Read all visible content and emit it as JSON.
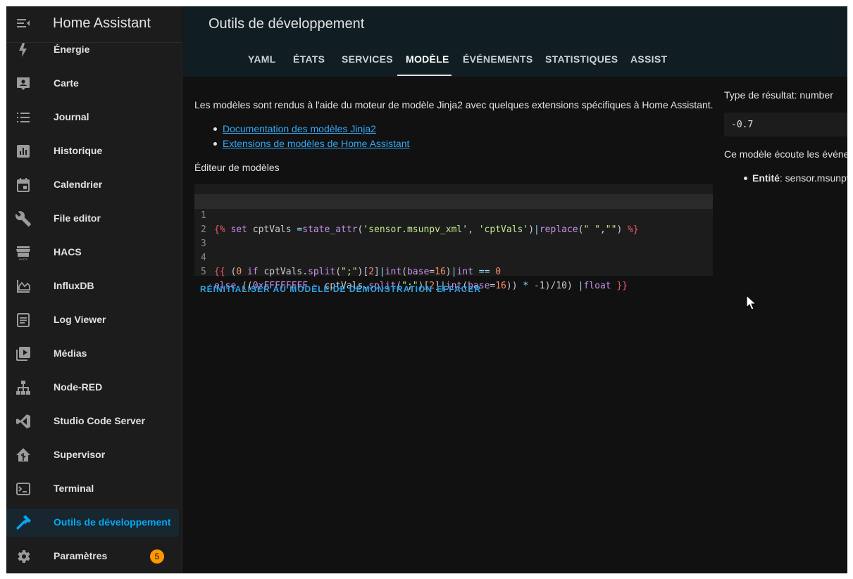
{
  "app": {
    "title": "Home Assistant"
  },
  "sidebar": {
    "items": [
      {
        "label": "Énergie",
        "icon": "lightning-bolt-icon"
      },
      {
        "label": "Carte",
        "icon": "account-box-icon"
      },
      {
        "label": "Journal",
        "icon": "list-icon"
      },
      {
        "label": "Historique",
        "icon": "chart-box-icon"
      },
      {
        "label": "Calendrier",
        "icon": "calendar-icon"
      },
      {
        "label": "File editor",
        "icon": "wrench-icon"
      },
      {
        "label": "HACS",
        "icon": "hacs-store-icon"
      },
      {
        "label": "InfluxDB",
        "icon": "area-chart-icon"
      },
      {
        "label": "Log Viewer",
        "icon": "text-document-icon"
      },
      {
        "label": "Médias",
        "icon": "play-box-multiple-icon"
      },
      {
        "label": "Node-RED",
        "icon": "sitemap-icon"
      },
      {
        "label": "Studio Code Server",
        "icon": "vscode-icon"
      },
      {
        "label": "Supervisor",
        "icon": "home-assistant-icon"
      },
      {
        "label": "Terminal",
        "icon": "console-icon"
      },
      {
        "label": "Outils de développement",
        "icon": "hammer-icon",
        "active": true
      },
      {
        "label": "Paramètres",
        "icon": "cog-icon",
        "badge": "5"
      }
    ]
  },
  "header": {
    "title": "Outils de développement",
    "tabs": [
      {
        "label": "YAML"
      },
      {
        "label": "ÉTATS"
      },
      {
        "label": "SERVICES"
      },
      {
        "label": "MODÈLE",
        "active": true
      },
      {
        "label": "ÉVÉNEMENTS"
      },
      {
        "label": "STATISTIQUES"
      },
      {
        "label": "ASSIST"
      }
    ]
  },
  "main": {
    "intro": "Les modèles sont rendus à l'aide du moteur de modèle Jinja2 avec quelques extensions spécifiques à Home Assistant.",
    "links": [
      "Documentation des modèles Jinja2",
      "Extensions de modèles de Home Assistant"
    ],
    "editor_label": "Éditeur de modèles",
    "code_lines": [
      "{% set cptVals =state_attr('sensor.msunpv_xml', 'cptVals')|replace(\" \",\"\") %}",
      "",
      "",
      "{{ (0 if cptVals.split(\";\")[2]|int(base=16)|int == 0",
      "else ((0xFFFFFFFF - cptVals.split(\";\")[2]|int(base=16)) * -1)/10) |float }}"
    ],
    "line_numbers": [
      "1",
      "2",
      "3",
      "4",
      "5"
    ],
    "reset_button": "RÉINITIALISER AU MODÈLE DE DÉMONSTRATION",
    "clear_button": "EFFACER"
  },
  "result": {
    "type_label": "Type de résultat: number",
    "value": "-0.7",
    "listen_text": "Ce modèle écoute les événe",
    "entity_label": "Entité",
    "entity_value": ": sensor.msunpv"
  },
  "colors": {
    "accent": "#03a9f4",
    "badge": "#ff9800",
    "topbar": "#101e24"
  }
}
